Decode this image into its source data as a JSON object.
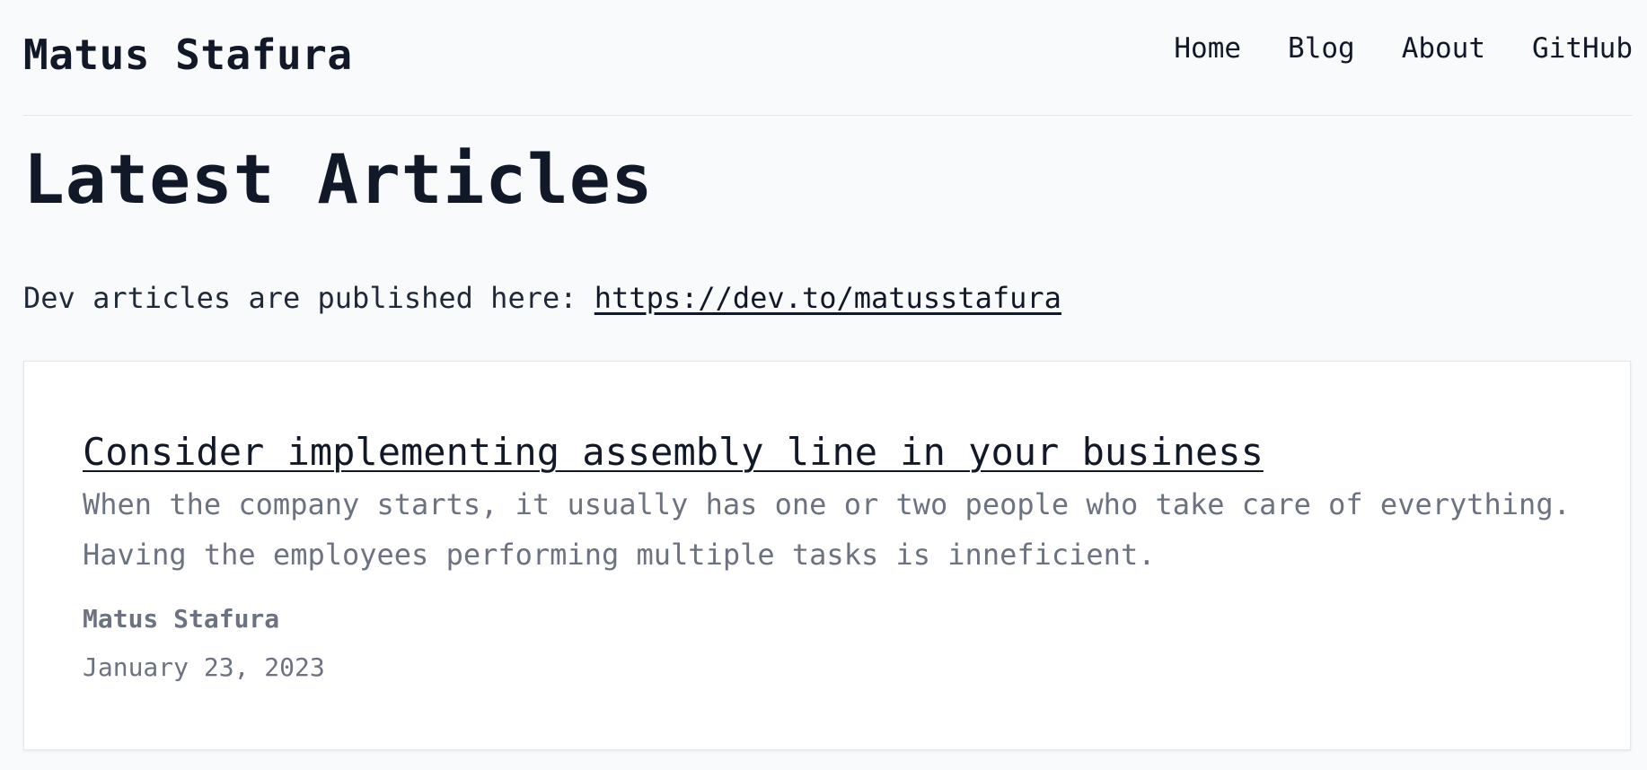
{
  "header": {
    "site_title": "Matus Stafura",
    "nav": [
      {
        "label": "Home"
      },
      {
        "label": "Blog"
      },
      {
        "label": "About"
      },
      {
        "label": "GitHub"
      }
    ]
  },
  "main": {
    "title": "Latest Articles",
    "intro_text": "Dev articles are published here: ",
    "intro_link": "https://dev.to/matusstafura",
    "articles": [
      {
        "title": "Consider implementing assembly line in your business",
        "excerpt": "When the company starts, it usually has one or two people who take care of everything. Having the employees performing multiple tasks is inneficient.",
        "author": "Matus Stafura",
        "date": "January 23, 2023"
      }
    ]
  },
  "colors": {
    "background": "#f8fafc",
    "text": "#111827",
    "muted": "#6b7280",
    "card": "#ffffff",
    "border": "#e5e7eb"
  }
}
